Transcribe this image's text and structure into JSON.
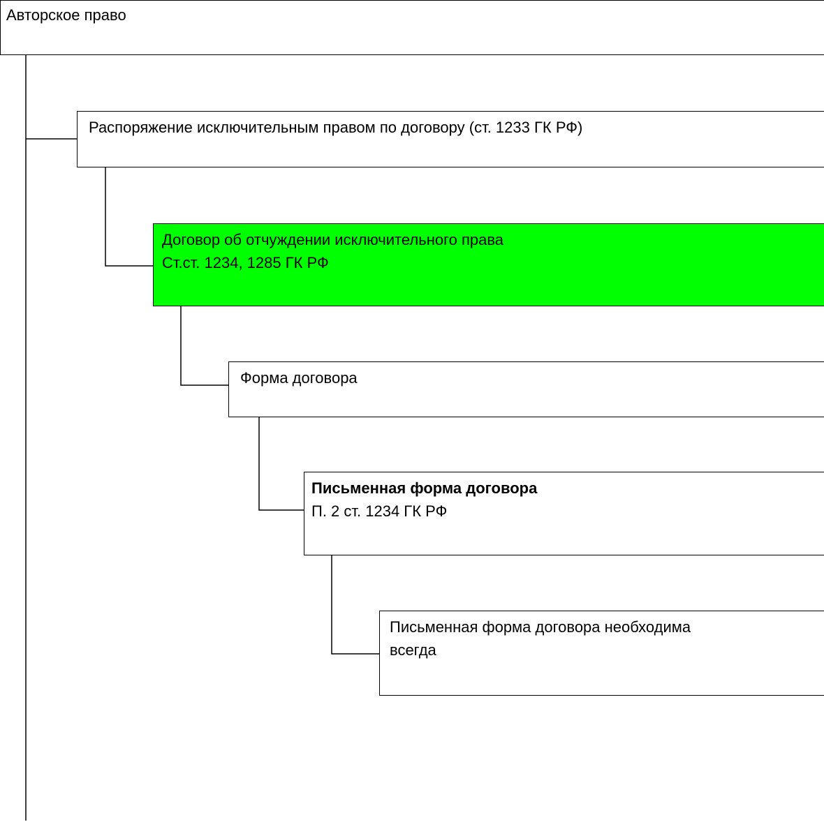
{
  "diagram": {
    "root": {
      "text": "Авторское право"
    },
    "nodes": [
      {
        "id": "node-1",
        "lines": [
          "Распоряжение исключительным правом по договору (ст. 1233 ГК РФ)"
        ]
      },
      {
        "id": "node-2",
        "lines": [
          "Договор об отчуждении исключительного права",
          "Ст.ст. 1234, 1285 ГК РФ"
        ],
        "highlight_color": "#00ff00"
      },
      {
        "id": "node-3",
        "lines": [
          "Форма договора"
        ]
      },
      {
        "id": "node-4",
        "lines": [
          "Письменная форма договора",
          "П. 2 ст. 1234 ГК РФ"
        ],
        "first_line_bold": true
      },
      {
        "id": "node-5",
        "lines": [
          "Письменная форма договора необходима",
          "всегда"
        ]
      }
    ]
  }
}
